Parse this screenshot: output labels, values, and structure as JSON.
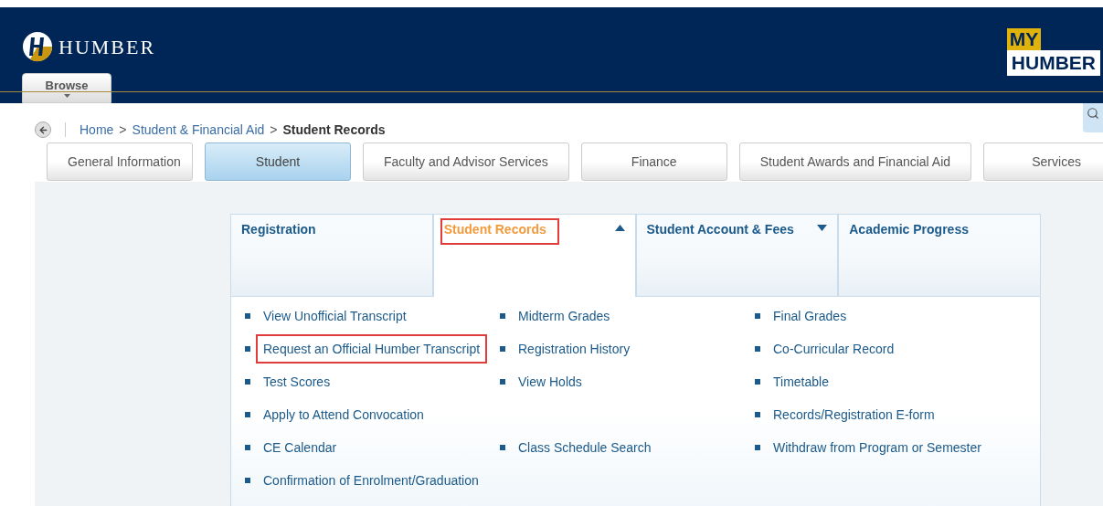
{
  "header": {
    "logo_text": "HUMBER",
    "browse_button": "Browse",
    "brand_badge": {
      "line_1": "MY",
      "line_2": "HUMBER"
    }
  },
  "breadcrumb": [
    {
      "label": "Home",
      "current": false
    },
    {
      "label": "Student & Financial Aid",
      "current": false
    },
    {
      "label": "Student Records",
      "current": true
    }
  ],
  "breadcrumb_separator": ">",
  "tabs": [
    {
      "label": "General Information",
      "selected": false
    },
    {
      "label": "Student",
      "selected": true
    },
    {
      "label": "Faculty and Advisor Services",
      "selected": false
    },
    {
      "label": "Finance",
      "selected": false
    },
    {
      "label": "Student Awards and Financial Aid",
      "selected": false
    },
    {
      "label": "Services",
      "selected": false
    }
  ],
  "menu_headers": [
    {
      "label": "Registration",
      "selected": false,
      "highlighted": false,
      "kind": "plain"
    },
    {
      "label": "Student Records",
      "selected": true,
      "highlighted": true,
      "kind": "dropdown"
    },
    {
      "label": "Student Account & Fees",
      "selected": false,
      "highlighted": false,
      "kind": "dropdown"
    },
    {
      "label": "Academic Progress",
      "selected": false,
      "highlighted": false,
      "kind": "plain"
    }
  ],
  "link_rows": [
    [
      {
        "label": "View Unofficial Transcript",
        "highlighted": false
      },
      {
        "label": "Midterm Grades",
        "highlighted": false
      },
      {
        "label": "Final Grades",
        "highlighted": false
      }
    ],
    [
      {
        "label": "Request an Official Humber Transcript",
        "highlighted": true
      },
      {
        "label": "Registration History",
        "highlighted": false
      },
      {
        "label": "Co-Curricular Record",
        "highlighted": false
      }
    ],
    [
      {
        "label": "Test Scores",
        "highlighted": false
      },
      {
        "label": "View Holds",
        "highlighted": false
      },
      {
        "label": "Timetable",
        "highlighted": false
      }
    ],
    [
      {
        "label": "Apply to Attend Convocation",
        "highlighted": false
      },
      null,
      {
        "label": "Records/Registration E-form",
        "highlighted": false
      }
    ],
    [
      {
        "label": "CE Calendar",
        "highlighted": false
      },
      {
        "label": "Class Schedule Search",
        "highlighted": false
      },
      {
        "label": "Withdraw from Program or Semester",
        "highlighted": false
      }
    ],
    [
      {
        "label": "Confirmation of Enrolment/Graduation",
        "highlighted": false
      },
      null,
      null
    ]
  ]
}
